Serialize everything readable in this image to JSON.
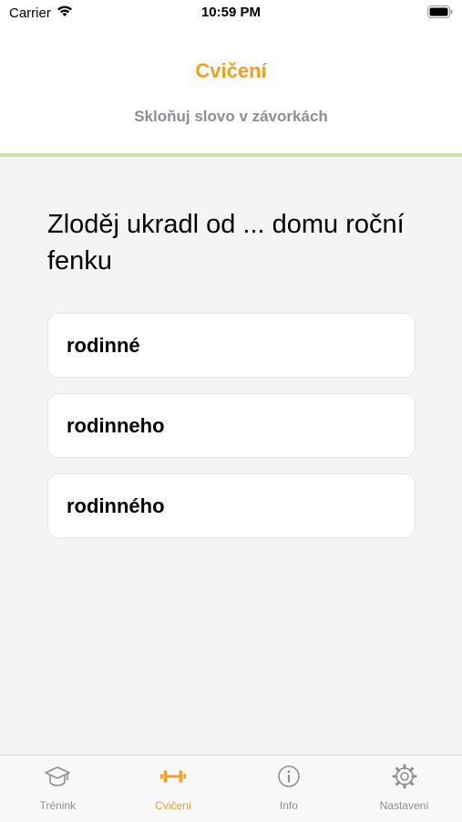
{
  "status_bar": {
    "carrier": "Carrier",
    "time": "10:59 PM"
  },
  "header": {
    "title": "Cvičení",
    "subtitle": "Skloňuj slovo v závorkách"
  },
  "question": {
    "text": "Zloděj ukradl od ... domu roční fenku"
  },
  "options": [
    {
      "label": "rodinné"
    },
    {
      "label": "rodinneho"
    },
    {
      "label": "rodinného"
    }
  ],
  "tab_bar": {
    "tabs": [
      {
        "label": "Trénink",
        "icon": "graduation-cap-icon",
        "active": false
      },
      {
        "label": "Cvičení",
        "icon": "dumbbell-icon",
        "active": true
      },
      {
        "label": "Info",
        "icon": "info-icon",
        "active": false
      },
      {
        "label": "Nastavení",
        "icon": "gear-icon",
        "active": false
      }
    ]
  },
  "colors": {
    "accent": "#f0a020",
    "inactive": "#8e8e93",
    "progress": "#c9e3a6",
    "content_background": "#f4f4f4"
  }
}
